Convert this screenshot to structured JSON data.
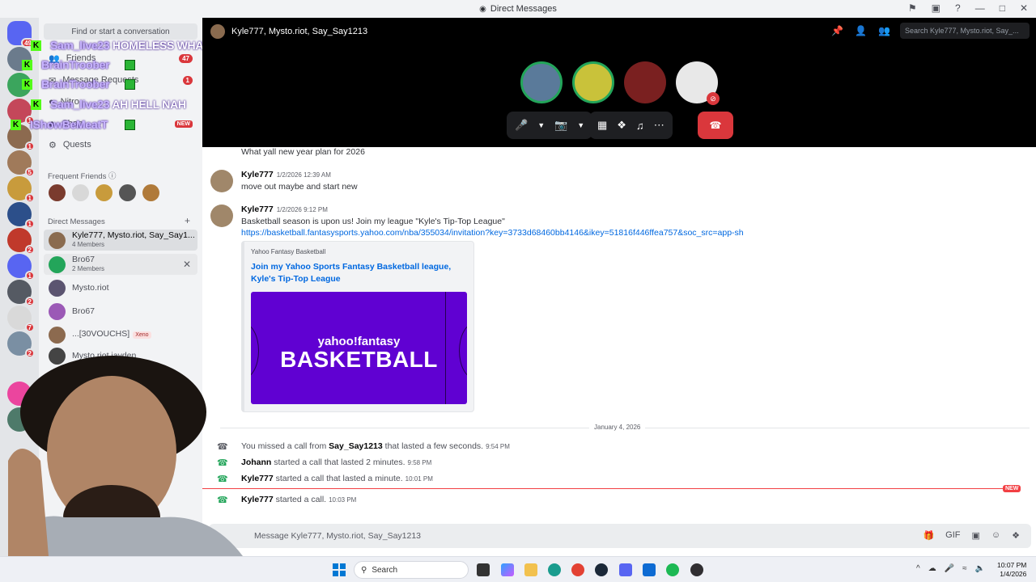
{
  "window": {
    "title": "Direct Messages"
  },
  "titlebar_icons": [
    "inbox-icon",
    "help-icon",
    "minimize-icon",
    "maximize-icon",
    "close-icon"
  ],
  "servers": [
    {
      "badge": "49"
    },
    {
      "badge": ""
    },
    {
      "badge": ""
    },
    {
      "badge": "1"
    },
    {
      "badge": "1"
    },
    {
      "badge": "5"
    },
    {
      "badge": "1"
    },
    {
      "badge": "1"
    },
    {
      "badge": "2"
    },
    {
      "badge": "1"
    },
    {
      "badge": "2"
    },
    {
      "badge": "7"
    },
    {
      "badge": "2"
    }
  ],
  "sidebar": {
    "search_placeholder": "Find or start a conversation",
    "nav": [
      {
        "label": "Friends",
        "count": "47"
      },
      {
        "label": "Message Requests",
        "count": "1"
      },
      {
        "label": "Nitro",
        "count": ""
      },
      {
        "label": "Shop",
        "new": "NEW"
      },
      {
        "label": "Quests"
      }
    ],
    "frequent_friends_title": "Frequent Friends",
    "dm_title": "Direct Messages",
    "dms": [
      {
        "name": "Kyle777, Mysto.riot, Say_Say1...",
        "sub": "4 Members"
      },
      {
        "name": "Bro67",
        "sub": "2 Members"
      },
      {
        "name": "Mysto.riot",
        "sub": ""
      },
      {
        "name": "Bro67",
        "sub": ""
      },
      {
        "name": "...[30VOUCHS]",
        "tag": "Xeno",
        "sub": ""
      },
      {
        "name": "Mysto.riot jayden",
        "sub": ""
      }
    ]
  },
  "stream_overlay": [
    {
      "user": "Sam_live23",
      "msg": "HOMELESS WHAT?"
    },
    {
      "user": "BrainTroober",
      "msg": ""
    },
    {
      "user": "BrainTroober",
      "msg": ""
    },
    {
      "user": "Sam_live23",
      "msg": "AH HELL NAH"
    },
    {
      "user": "IShowBeMeatT",
      "msg": ""
    }
  ],
  "call": {
    "group_name": "Kyle777, Mysto.riot, Say_Say1213",
    "search_placeholder": "Search Kyle777, Mysto.riot, Say_..."
  },
  "messages": [
    {
      "text": "What yall new year plan for 2026"
    },
    {
      "author": "Kyle777",
      "time": "1/2/2026 12:39 AM",
      "text": "move out maybe and start new"
    },
    {
      "author": "Kyle777",
      "time": "1/2/2026 9:12 PM",
      "text": "Basketball season is upon us! Join my league \"Kyle's Tip-Top League\"",
      "link": "https://basketball.fantasysports.yahoo.com/nba/355034/invitation?key=3733d68460bb4146&ikey=51816f446ffea757&soc_src=app-sh"
    }
  ],
  "embed": {
    "provider": "Yahoo Fantasy Basketball",
    "title": "Join my Yahoo Sports Fantasy Basketball league, Kyle's Tip-Top League",
    "brand": "yahoo!fantasy",
    "headline": "BASKETBALL"
  },
  "date_divider": "January 4, 2026",
  "call_events": [
    {
      "pre": "You missed a call from ",
      "who": "Say_Say1213",
      "post": " that lasted a few seconds.",
      "time": "9:54 PM"
    },
    {
      "pre": "",
      "who": "Johann",
      "post": " started a call that lasted 2 minutes.",
      "time": "9:58 PM"
    },
    {
      "pre": "",
      "who": "Kyle777",
      "post": " started a call that lasted a minute.",
      "time": "10:01 PM"
    },
    {
      "pre": "",
      "who": "Kyle777",
      "post": " started a call.",
      "time": "10:03 PM"
    }
  ],
  "new_badge": "NEW",
  "composer": {
    "placeholder": "Message Kyle777, Mysto.riot, Say_Say1213"
  },
  "taskbar": {
    "search_label": "Search",
    "time": "10:07 PM",
    "date": "1/4/2026"
  }
}
